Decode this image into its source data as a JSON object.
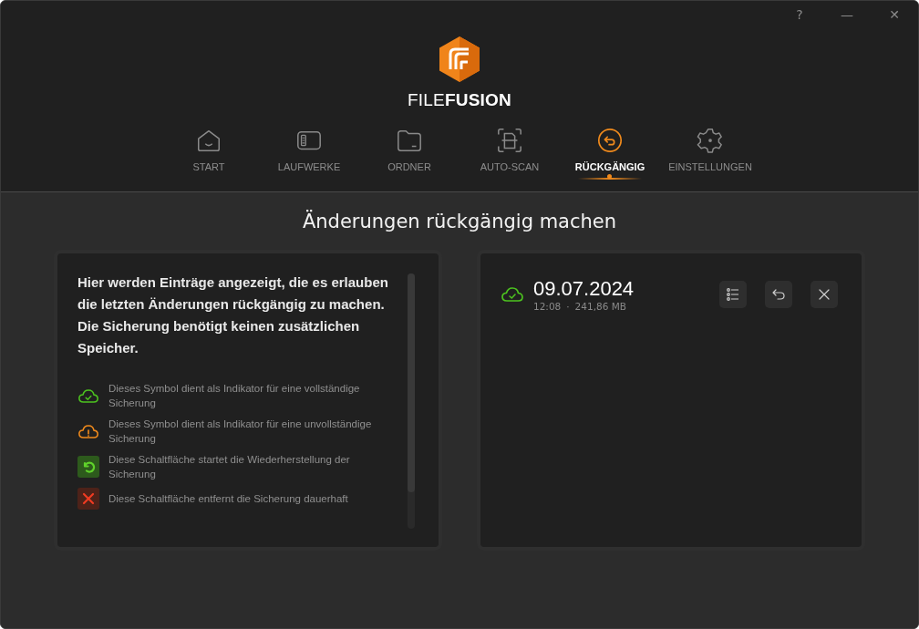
{
  "window": {
    "controls": [
      "?",
      "—",
      "✕"
    ]
  },
  "logo": {
    "text": "FILE**FUSION**"
  },
  "tabs": [
    {
      "label": "START",
      "kind": "home",
      "selected": false
    },
    {
      "label": "LAUFWERKE",
      "kind": "drive",
      "selected": false
    },
    {
      "label": "ORDNER",
      "kind": "folder",
      "selected": false
    },
    {
      "label": "AUTO-SCAN",
      "kind": "scan",
      "selected": false
    },
    {
      "label": "RÜCKGÄNGIG",
      "kind": "undo",
      "selected": true
    },
    {
      "label": "EINSTELLUNGEN",
      "kind": "gear",
      "selected": false
    }
  ],
  "page_title": "Änderungen rückgängig machen",
  "info": {
    "intro": "Hier werden Einträge angezeigt, die es erlauben die letzten Änderungen rückgängig zu machen. Die Sicherung benötigt keinen zusätzlichen Speicher.",
    "legend": [
      {
        "kind": "complete",
        "text": "Dieses Symbol dient als Indikator für eine vollständige Sicherung"
      },
      {
        "kind": "incomplete",
        "text": "Dieses Symbol dient als Indikator für eine unvollständige Sicherung"
      },
      {
        "kind": "restore",
        "text": "Diese Schaltfläche startet die Wiederherstellung der Sicherung"
      },
      {
        "kind": "delete",
        "text": "Diese Schaltfläche entfernt die Sicherung dauerhaft"
      }
    ]
  },
  "backups": [
    {
      "kind": "complete",
      "date": "09.07.2024",
      "time": "12:08",
      "separator": "·",
      "size": "241,86 MB"
    }
  ]
}
